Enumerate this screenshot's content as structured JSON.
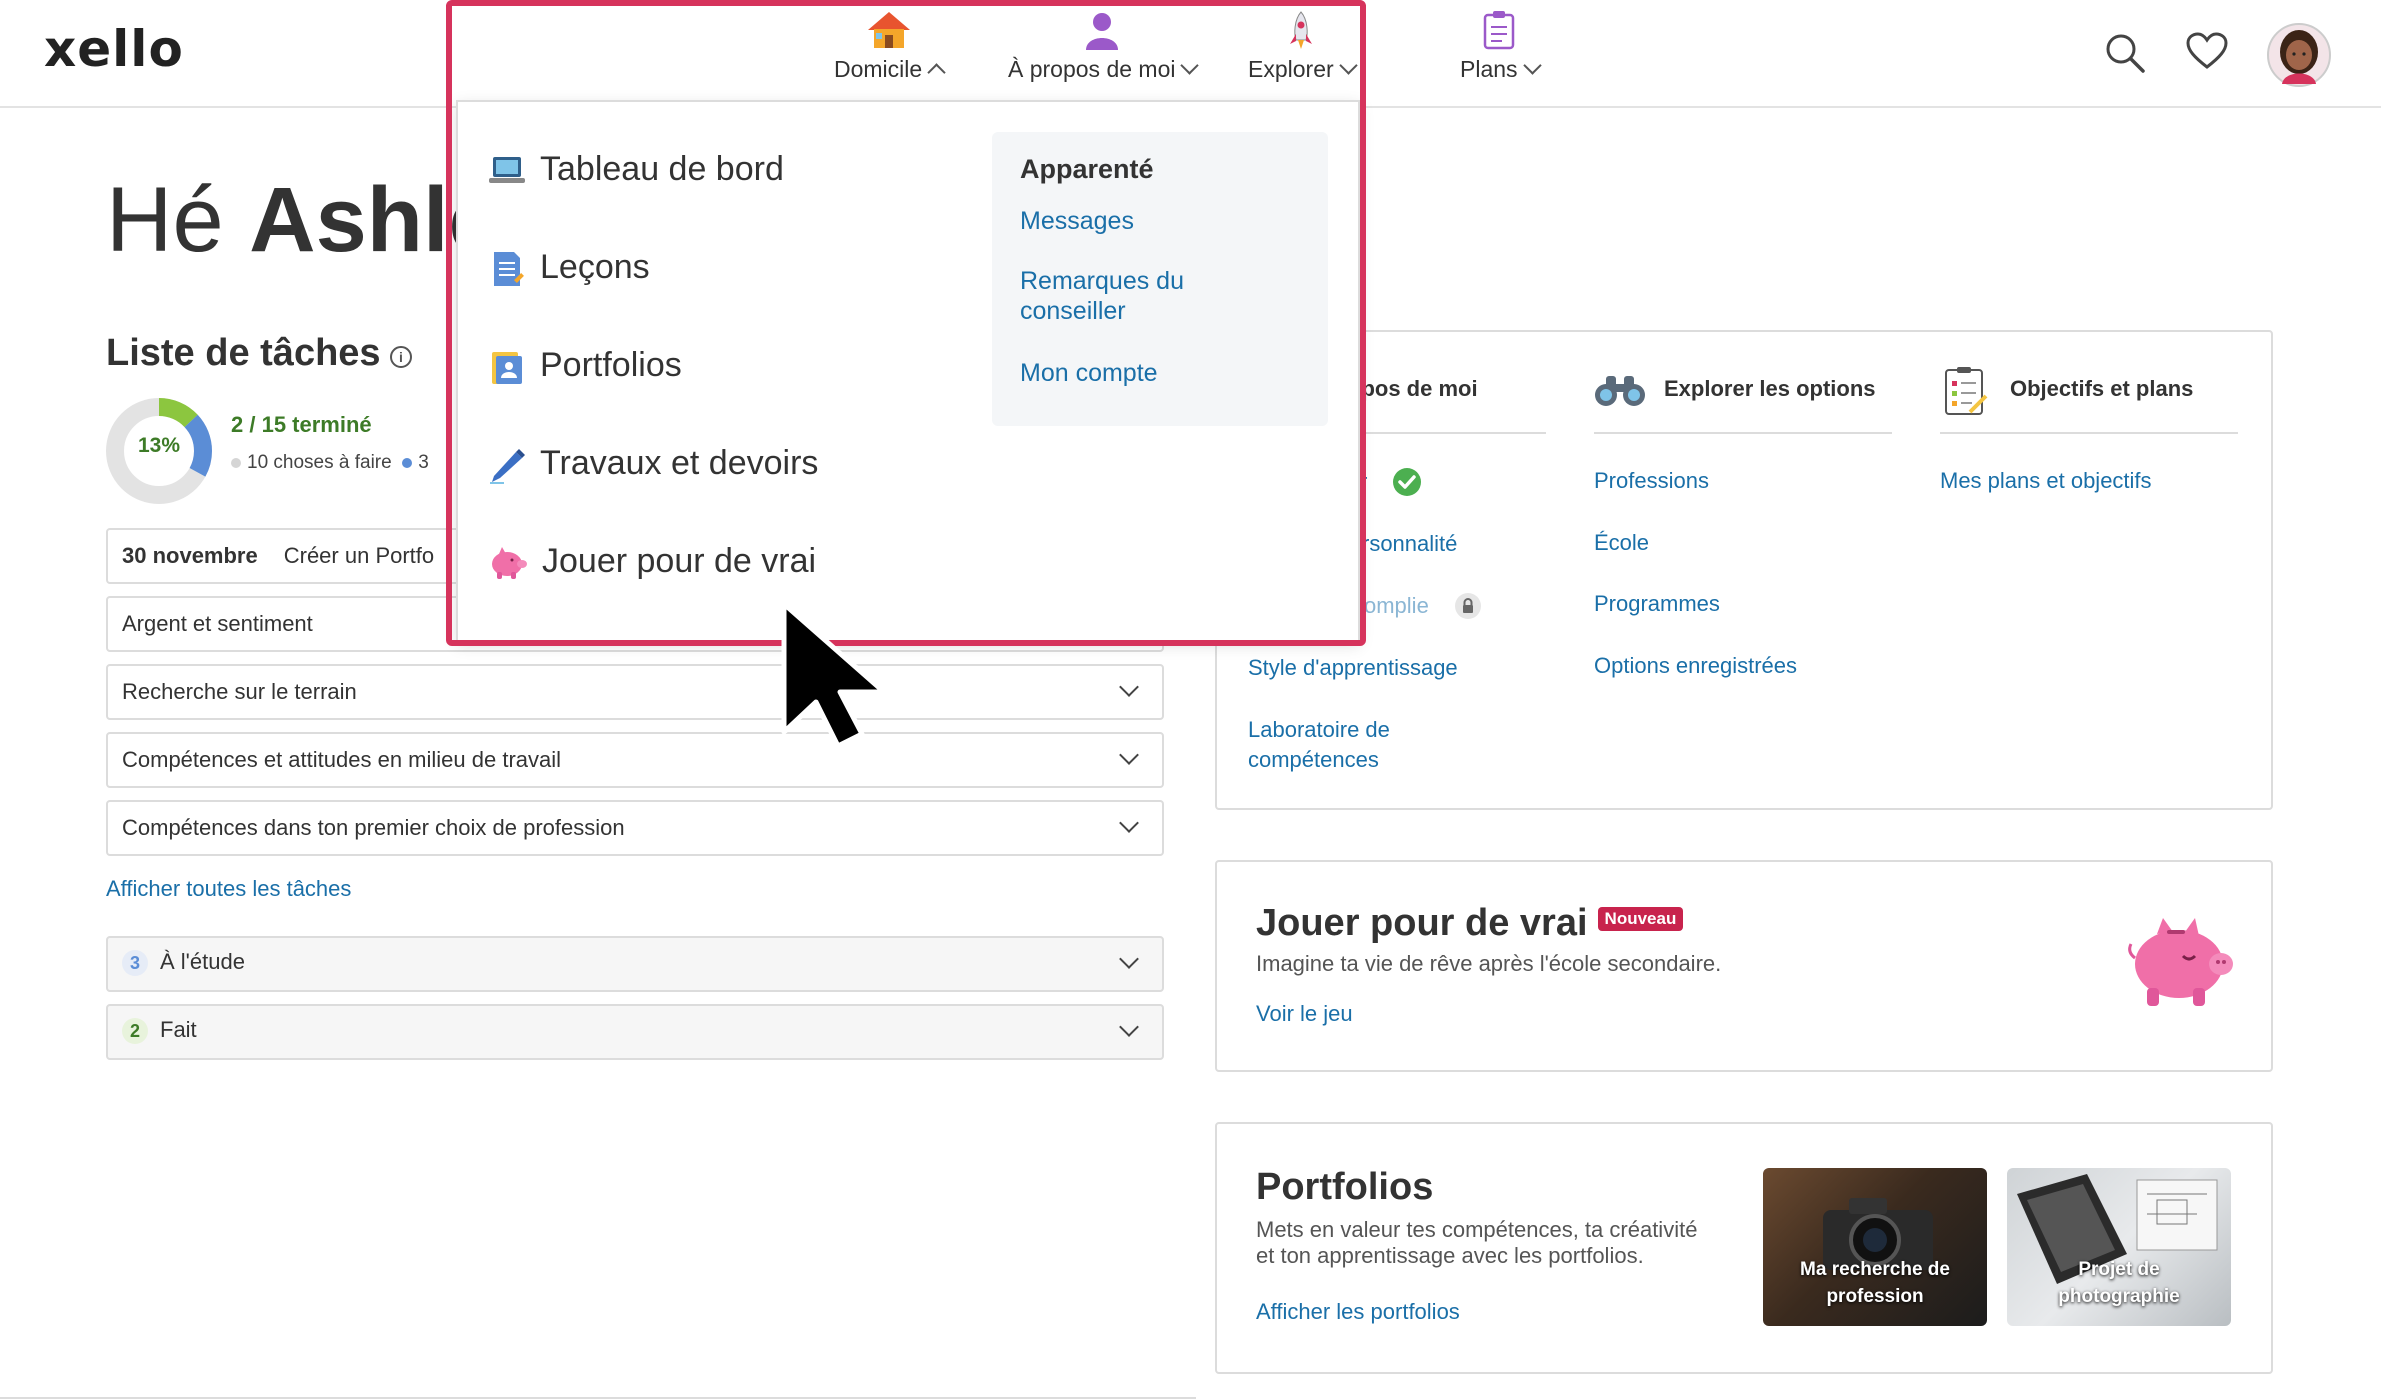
{
  "header": {
    "logo": "xello",
    "nav": [
      {
        "label": "Domicile",
        "icon": "house-icon",
        "expanded": true
      },
      {
        "label": "À propos de moi",
        "icon": "person-icon"
      },
      {
        "label": "Explorer",
        "icon": "rocket-icon"
      },
      {
        "label": "Plans",
        "icon": "clipboard-icon"
      }
    ],
    "icons": [
      "search-icon",
      "heart-icon",
      "avatar"
    ]
  },
  "greeting": {
    "prefix": "Hé",
    "name": "Ashle"
  },
  "tasks": {
    "title": "Liste de tâches",
    "percent": "13%",
    "percent_value": 13,
    "done": "2",
    "total": "/ 15 terminé",
    "todo": "10 choses à faire",
    "in_progress": "3",
    "first_row": {
      "date": "30 novembre",
      "label": "Créer un Portfo"
    },
    "rows": [
      "Argent et sentiment",
      "Recherche sur le terrain",
      "Compétences et attitudes en milieu de travail",
      "Compétences dans ton premier choix de profession"
    ],
    "show_all": "Afficher toutes les tâches",
    "groups": [
      {
        "count": "3",
        "label": "À l'étude"
      },
      {
        "count": "2",
        "label": "Fait"
      }
    ]
  },
  "overview": {
    "col1": {
      "header": "opos de moi",
      "items": [
        "r",
        "rsonnalité",
        "omplie",
        "Style d'apprentissage",
        "Laboratoire de compétences"
      ]
    },
    "col2": {
      "header": "Explorer les options",
      "items": [
        "Professions",
        "École",
        "Programmes",
        "Options enregistrées"
      ]
    },
    "col3": {
      "header": "Objectifs et plans",
      "items": [
        "Mes plans et objectifs"
      ]
    }
  },
  "game_card": {
    "title": "Jouer pour de vrai",
    "badge": "Nouveau",
    "desc": "Imagine ta vie de rêve après l'école secondaire.",
    "link": "Voir le jeu"
  },
  "portfolio_card": {
    "title": "Portfolios",
    "desc_line1": "Mets en valeur tes compétences, ta créativité",
    "desc_line2": "et ton apprentissage avec les portfolios.",
    "link": "Afficher les portfolios",
    "tiles": [
      {
        "line1": "Ma recherche de",
        "line2": "profession"
      },
      {
        "line1": "Projet de",
        "line2": "photographie"
      }
    ]
  },
  "dropdown": {
    "items": [
      {
        "label": "Tableau de bord",
        "icon": "laptop-icon"
      },
      {
        "label": "Leçons",
        "icon": "document-icon"
      },
      {
        "label": "Portfolios",
        "icon": "portfolio-icon"
      },
      {
        "label": "Travaux et devoirs",
        "icon": "pen-icon"
      },
      {
        "label": "Jouer pour de vrai",
        "icon": "piggy-bank-icon"
      }
    ],
    "related": {
      "title": "Apparenté",
      "links": [
        "Messages",
        "Remarques du",
        "conseiller",
        "Mon compte"
      ]
    }
  },
  "colors": {
    "link": "#1a6fa8",
    "highlight": "#d6335c",
    "progress_green": "#8cc63f",
    "progress_blue": "#5b8dd6",
    "badge": "#c8234d"
  }
}
